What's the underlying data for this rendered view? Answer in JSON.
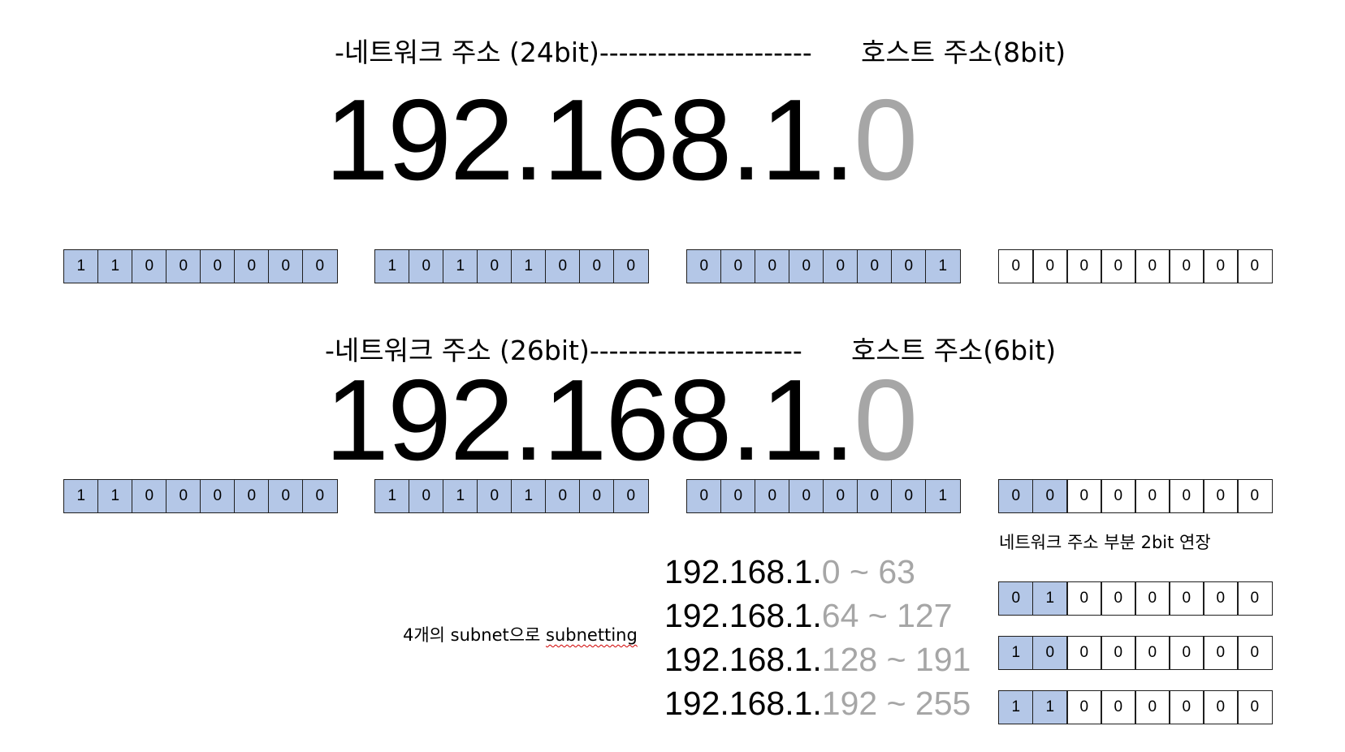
{
  "section1": {
    "network_label": "-네트워크 주소 (24bit)----------------------",
    "host_label": "호스트 주소(8bit)",
    "ip_network_part": "192.168.1.",
    "ip_host_part": "0",
    "octets": [
      {
        "bits": [
          "1",
          "1",
          "0",
          "0",
          "0",
          "0",
          "0",
          "0"
        ],
        "shaded": [
          1,
          1,
          1,
          1,
          1,
          1,
          1,
          1
        ]
      },
      {
        "bits": [
          "1",
          "0",
          "1",
          "0",
          "1",
          "0",
          "0",
          "0"
        ],
        "shaded": [
          1,
          1,
          1,
          1,
          1,
          1,
          1,
          1
        ]
      },
      {
        "bits": [
          "0",
          "0",
          "0",
          "0",
          "0",
          "0",
          "0",
          "1"
        ],
        "shaded": [
          1,
          1,
          1,
          1,
          1,
          1,
          1,
          1
        ]
      },
      {
        "bits": [
          "0",
          "0",
          "0",
          "0",
          "0",
          "0",
          "0",
          "0"
        ],
        "shaded": [
          0,
          0,
          0,
          0,
          0,
          0,
          0,
          0
        ]
      }
    ]
  },
  "section2": {
    "network_label": "-네트워크 주소 (26bit)----------------------",
    "host_label": "호스트 주소(6bit)",
    "ip_network_part": "192.168.1.",
    "ip_host_part": "0",
    "octets": [
      {
        "bits": [
          "1",
          "1",
          "0",
          "0",
          "0",
          "0",
          "0",
          "0"
        ],
        "shaded": [
          1,
          1,
          1,
          1,
          1,
          1,
          1,
          1
        ]
      },
      {
        "bits": [
          "1",
          "0",
          "1",
          "0",
          "1",
          "0",
          "0",
          "0"
        ],
        "shaded": [
          1,
          1,
          1,
          1,
          1,
          1,
          1,
          1
        ]
      },
      {
        "bits": [
          "0",
          "0",
          "0",
          "0",
          "0",
          "0",
          "0",
          "1"
        ],
        "shaded": [
          1,
          1,
          1,
          1,
          1,
          1,
          1,
          1
        ]
      },
      {
        "bits": [
          "0",
          "0",
          "0",
          "0",
          "0",
          "0",
          "0",
          "0"
        ],
        "shaded": [
          1,
          1,
          0,
          0,
          0,
          0,
          0,
          0
        ]
      }
    ],
    "extension_note": "네트워크 주소 부분 2bit 연장"
  },
  "subnet_note": {
    "prefix": "4개의 subnet으로 ",
    "word": "subnetting"
  },
  "subnets": [
    {
      "network": "192.168.1.",
      "range": "0 ~ 63",
      "bits": [
        "0",
        "1",
        "0",
        "0",
        "0",
        "0",
        "0",
        "0"
      ],
      "shaded": [
        1,
        1,
        0,
        0,
        0,
        0,
        0,
        0
      ]
    },
    {
      "network": "192.168.1.",
      "range": "64 ~ 127",
      "bits": [
        "1",
        "0",
        "0",
        "0",
        "0",
        "0",
        "0",
        "0"
      ],
      "shaded": [
        1,
        1,
        0,
        0,
        0,
        0,
        0,
        0
      ]
    },
    {
      "network": "192.168.1.",
      "range": "128 ~ 191",
      "bits": [
        "1",
        "1",
        "0",
        "0",
        "0",
        "0",
        "0",
        "0"
      ],
      "shaded": [
        1,
        1,
        0,
        0,
        0,
        0,
        0,
        0
      ]
    },
    {
      "network": "192.168.1.",
      "range": "192 ~ 255",
      "bits": [
        "",
        "",
        "",
        "",
        "",
        "",
        "",
        ""
      ],
      "shaded": [
        0,
        0,
        0,
        0,
        0,
        0,
        0,
        0
      ]
    }
  ],
  "colors": {
    "shade": "#b4c7e7",
    "host_gray": "#a6a6a6",
    "border": "#1f1f1f"
  }
}
